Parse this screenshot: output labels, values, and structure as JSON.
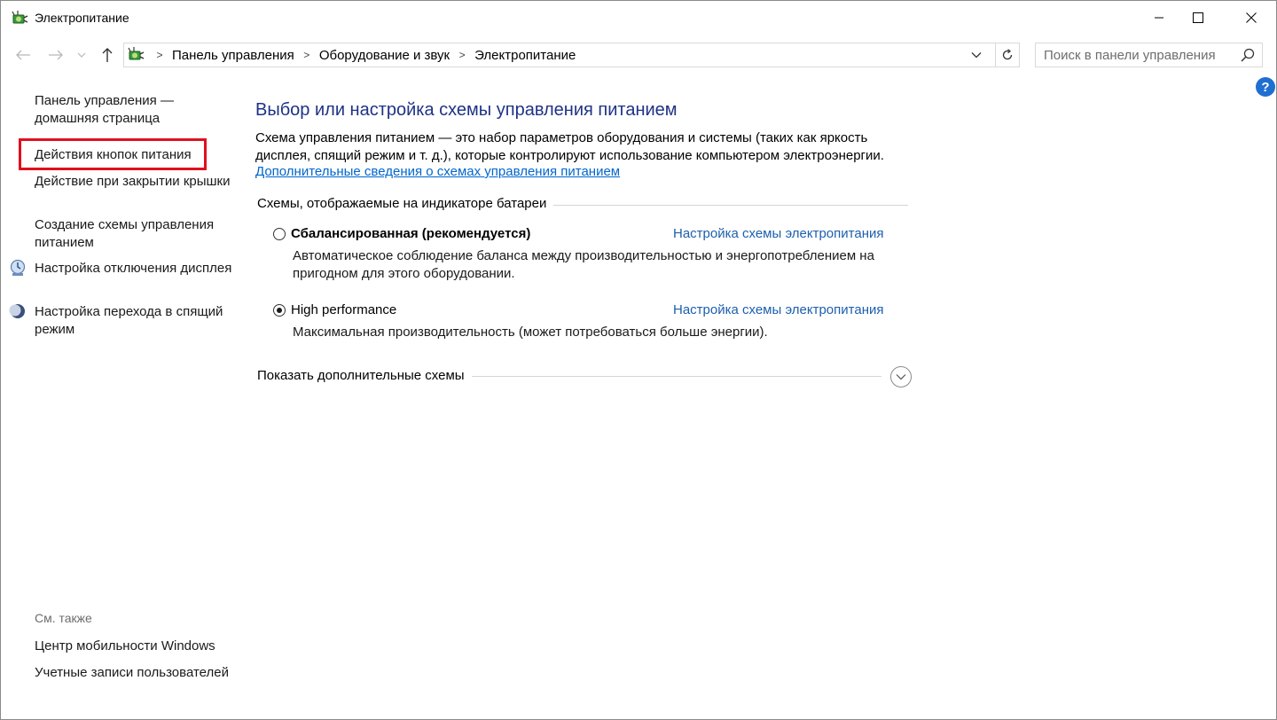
{
  "window": {
    "title": "Электропитание",
    "icon": "power-options-icon"
  },
  "controls": {
    "minimize": "minimize-icon",
    "maximize": "maximize-icon",
    "close": "close-icon"
  },
  "breadcrumb": [
    "Панель управления",
    "Оборудование и звук",
    "Электропитание"
  ],
  "search": {
    "placeholder": "Поиск в панели управления",
    "value": ""
  },
  "sidebar": {
    "items": [
      {
        "label": "Панель управления — домашняя страница",
        "icon": null
      },
      {
        "label": "Действия кнопок питания",
        "icon": null,
        "highlighted": true
      },
      {
        "label": "Действие при закрытии крышки",
        "icon": null
      },
      {
        "label": "Создание схемы управления питанием",
        "icon": null
      },
      {
        "label": "Настройка отключения дисплея",
        "icon": "display-timer-icon"
      },
      {
        "label": "Настройка перехода в спящий режим",
        "icon": "sleep-moon-icon"
      }
    ],
    "see_also_title": "См. также",
    "see_also": [
      {
        "label": "Центр мобильности Windows"
      },
      {
        "label": "Учетные записи пользователей"
      }
    ]
  },
  "main": {
    "title": "Выбор или настройка схемы управления питанием",
    "description": "Схема управления питанием — это набор параметров оборудования и системы (таких как яркость дисплея, спящий режим и т. д.), которые контролируют использование компьютером электроэнергии.",
    "more_link": "Дополнительные сведения о схемах управления питанием",
    "group_title": "Схемы, отображаемые на индикаторе батареи",
    "plans": [
      {
        "name": "Сбалансированная (рекомендуется)",
        "selected": false,
        "link": "Настройка схемы электропитания",
        "description": "Автоматическое соблюдение баланса между производительностью и энергопотреблением на пригодном для этого оборудовании."
      },
      {
        "name": "High performance",
        "selected": true,
        "link": "Настройка схемы электропитания",
        "description": "Максимальная производительность (может потребоваться больше энергии)."
      }
    ],
    "show_more": "Показать дополнительные схемы"
  },
  "colors": {
    "title_blue": "#1e3287",
    "link_blue": "#1c5fae",
    "highlight_red": "#e0101e",
    "help_blue": "#1f6fd1"
  }
}
